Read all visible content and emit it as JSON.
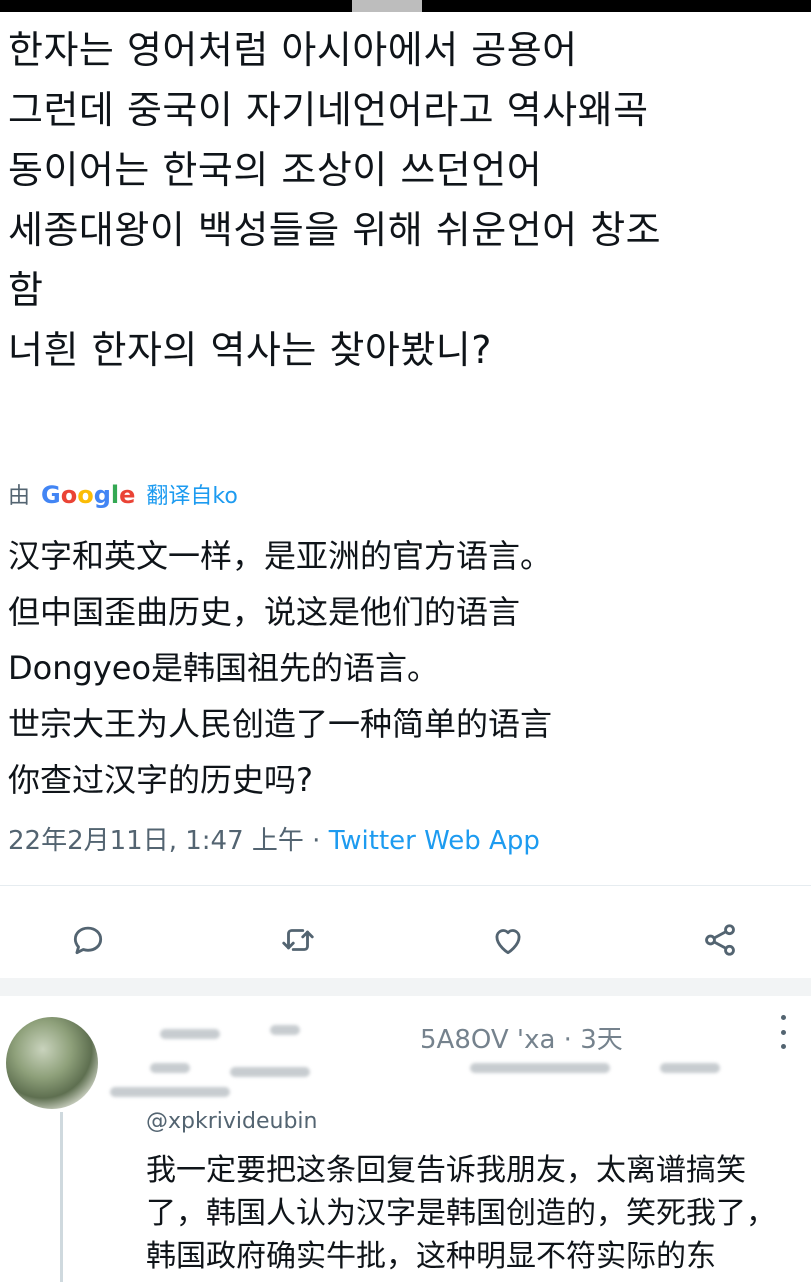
{
  "tweet": {
    "lines": [
      "한자는 영어처럼 아시아에서 공용어",
      "그런데 중국이 자기네언어라고 역사왜곡",
      "동이어는 한국의 조상이 쓰던언어",
      "세종대왕이 백성들을 위해 쉬운언어 창조",
      "함",
      "너흰 한자의 역사는 찾아봤니?"
    ],
    "translation_prefix": "由",
    "translation_brand": "Google",
    "translation_suffix": "翻译自ko",
    "translated_lines": [
      "汉字和英文一样，是亚洲的官方语言。",
      "但中国歪曲历史，说这是他们的语言",
      "Dongyeo是韩国祖先的语言。",
      "世宗大王为人民创造了一种简单的语言",
      "你查过汉字的历史吗?"
    ],
    "timestamp": "22年2月11日, 1:47 上午 · ",
    "source_app": "Twitter Web App"
  },
  "actions": [
    {
      "name": "reply-icon"
    },
    {
      "name": "retweet-icon"
    },
    {
      "name": "like-icon"
    },
    {
      "name": "share-icon"
    }
  ],
  "reply": {
    "time": "5A8OV  'xa · 3天",
    "handle": "@xpkrivideubin",
    "lines": [
      "我一定要把这条回复告诉我朋友，太离谱搞笑",
      "了，韩国人认为汉字是韩国创造的，笑死我了，",
      "韩国政府确实牛批，这种明显不符实际的东"
    ]
  },
  "colors": {
    "text": "#0f1419",
    "secondary": "#536471",
    "accent": "#1d9bf0"
  }
}
